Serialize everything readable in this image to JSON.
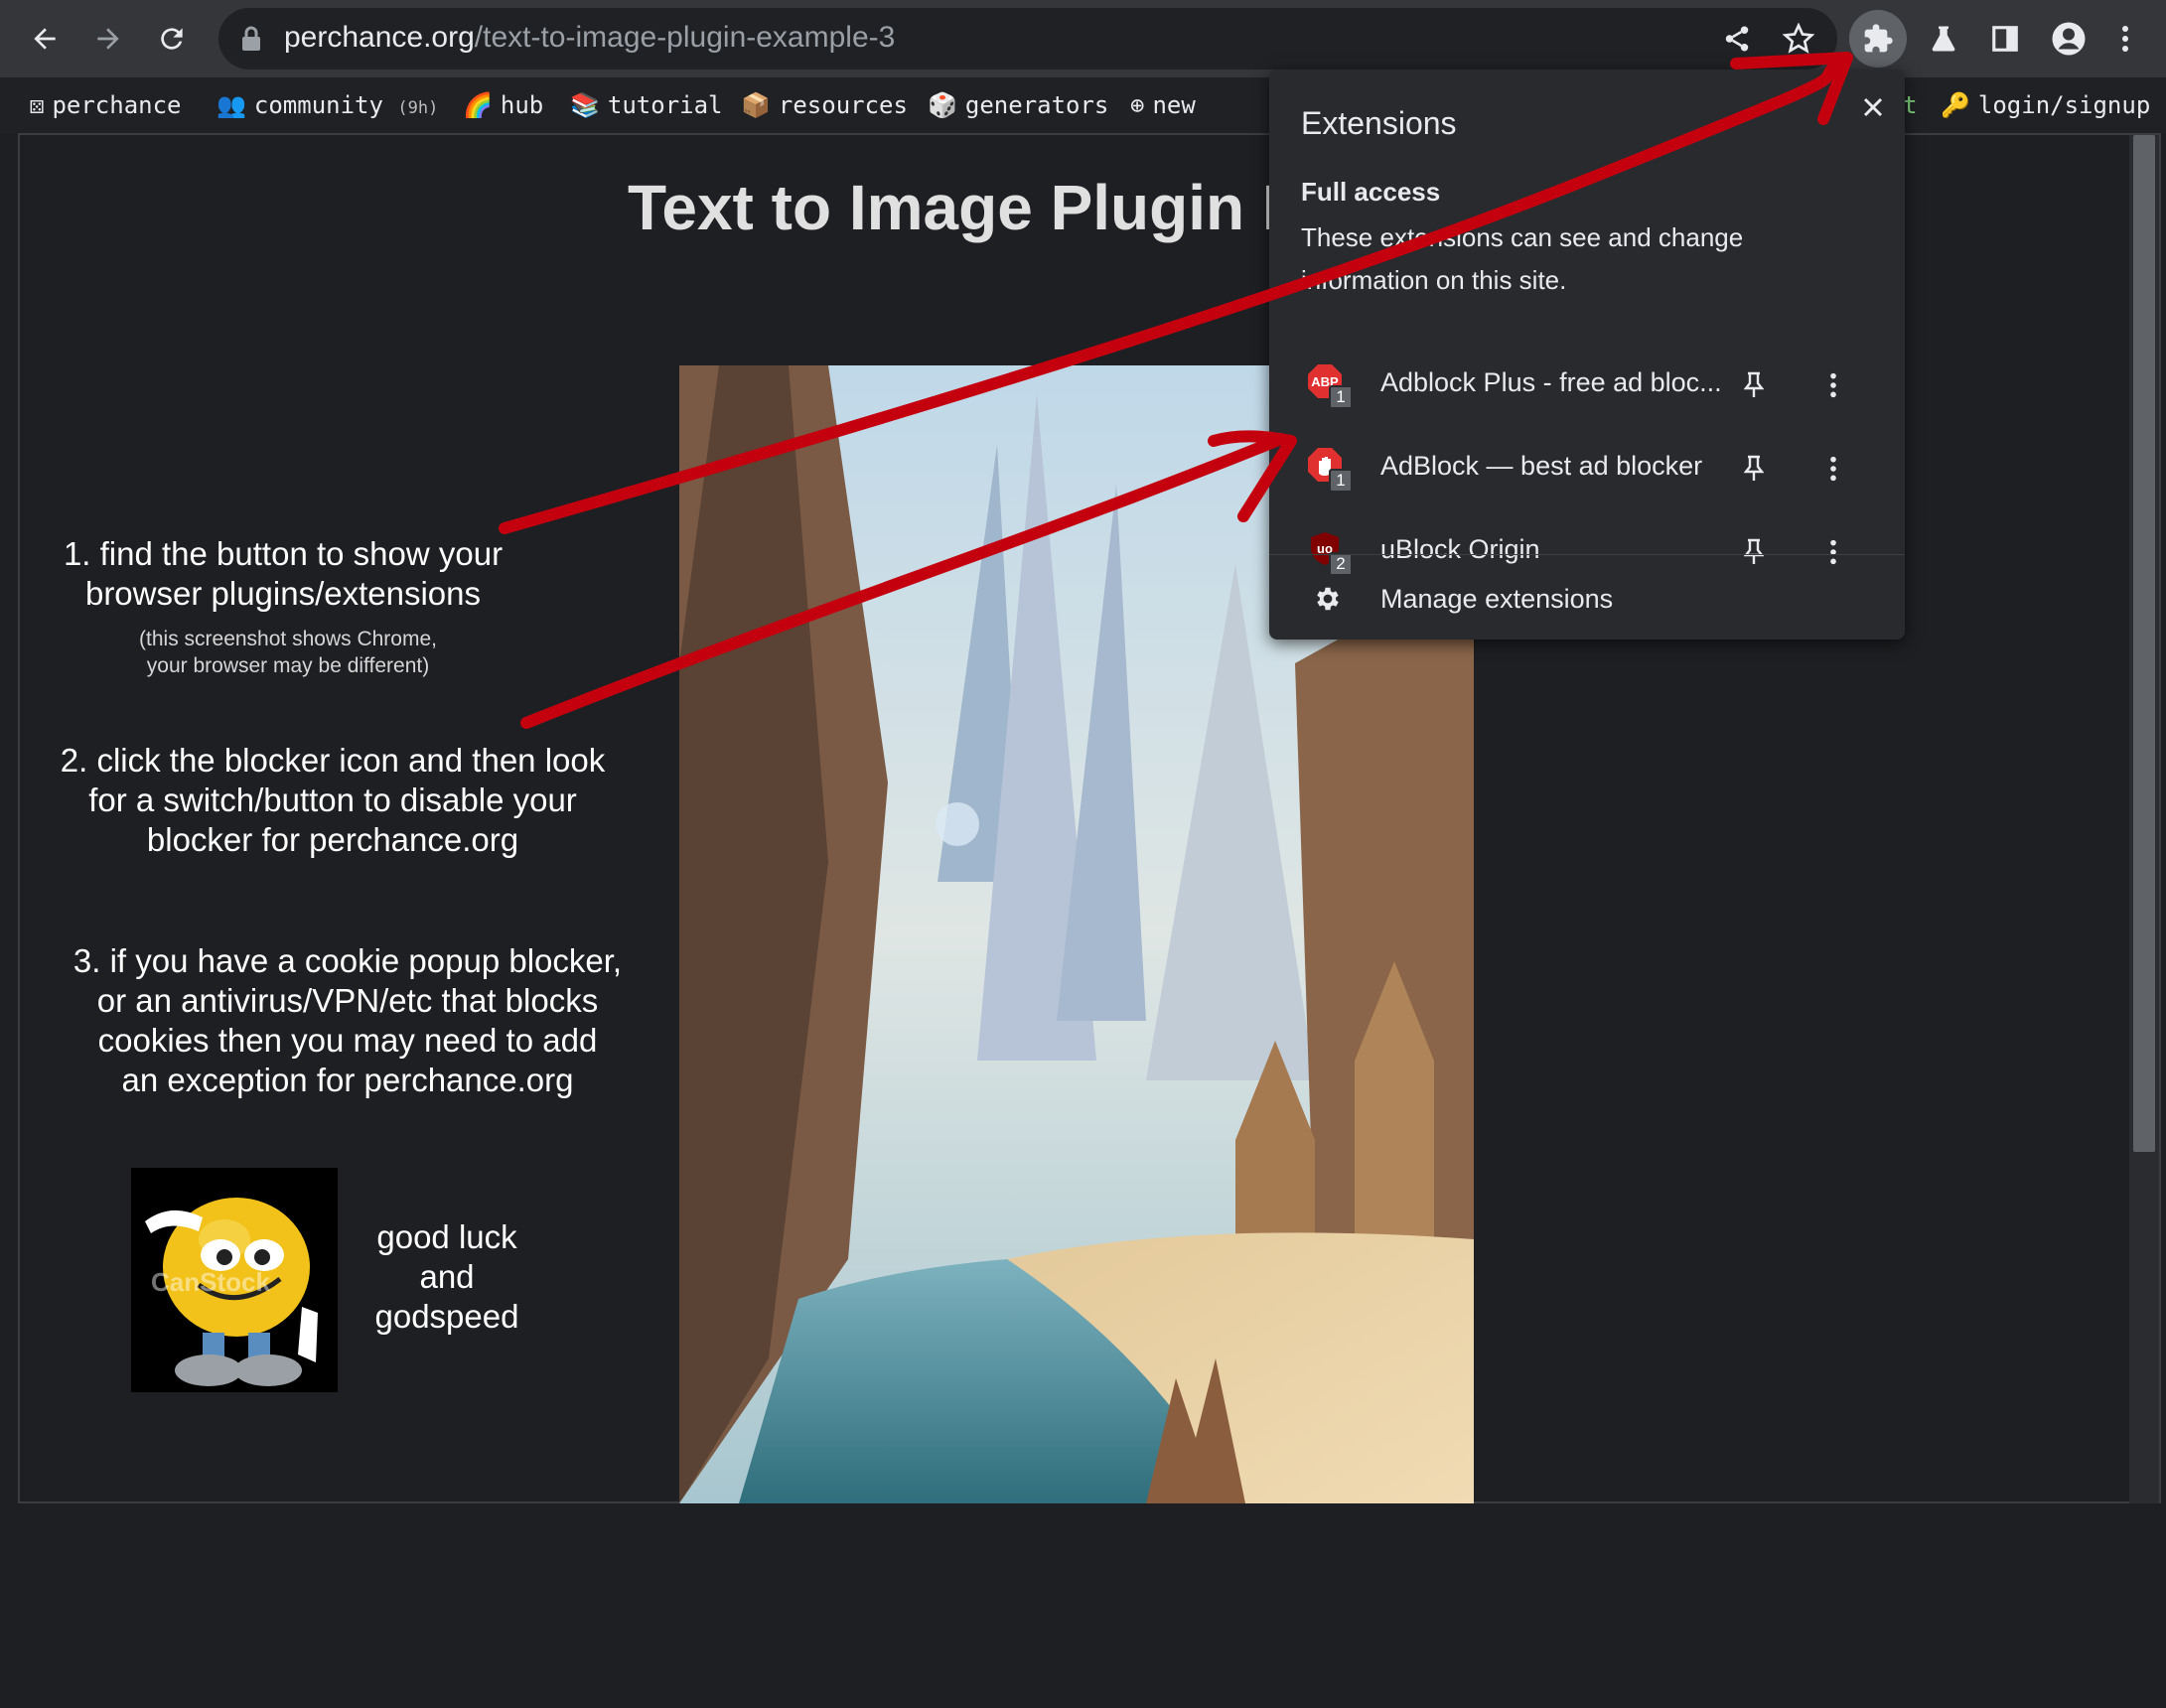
{
  "browser": {
    "url_host": "perchance.org",
    "url_path": "/text-to-image-plugin-example-3"
  },
  "sitenav": {
    "items": [
      {
        "label": "perchance",
        "icon": "dice-icon"
      },
      {
        "label": "community",
        "badge": "(9h)",
        "icon": "people-icon"
      },
      {
        "label": "hub",
        "icon": "rainbow-icon"
      },
      {
        "label": "tutorial",
        "icon": "books-icon"
      },
      {
        "label": "resources",
        "icon": "package-icon"
      },
      {
        "label": "generators",
        "icon": "die-icon"
      },
      {
        "label": "new",
        "icon": "plus-circle-icon"
      }
    ],
    "partial_right": "t",
    "login_label": "login/signup"
  },
  "page": {
    "title": "Text to Image Plugin E",
    "step1": [
      "1. find the button to show your",
      "browser plugins/extensions"
    ],
    "step1_note": [
      "(this screenshot shows Chrome,",
      "your browser may be different)"
    ],
    "step2": [
      "2. click the blocker icon and then look",
      "for a switch/button to disable your",
      "blocker for perchance.org"
    ],
    "step3": [
      "3. if you have a cookie popup blocker,",
      "or an antivirus/VPN/etc that blocks",
      "cookies then you may need to add",
      "an exception for perchance.org"
    ],
    "goodluck": [
      "good luck",
      "and",
      "godspeed"
    ],
    "watermark": "CanStock"
  },
  "extensions_popup": {
    "title": "Extensions",
    "access_heading": "Full access",
    "access_desc": "These extensions can see and change information on this site.",
    "items": [
      {
        "name": "Adblock Plus - free ad bloc...",
        "badge": "1",
        "icon": "abp-icon"
      },
      {
        "name": "AdBlock — best ad blocker",
        "badge": "1",
        "icon": "adblock-hand-icon"
      },
      {
        "name": "uBlock Origin",
        "badge": "2",
        "icon": "ublock-shield-icon"
      }
    ],
    "manage_label": "Manage extensions"
  },
  "colors": {
    "annotation_arrow": "#c4000f",
    "toolbar": "#35363a",
    "popup": "#292a2d"
  }
}
